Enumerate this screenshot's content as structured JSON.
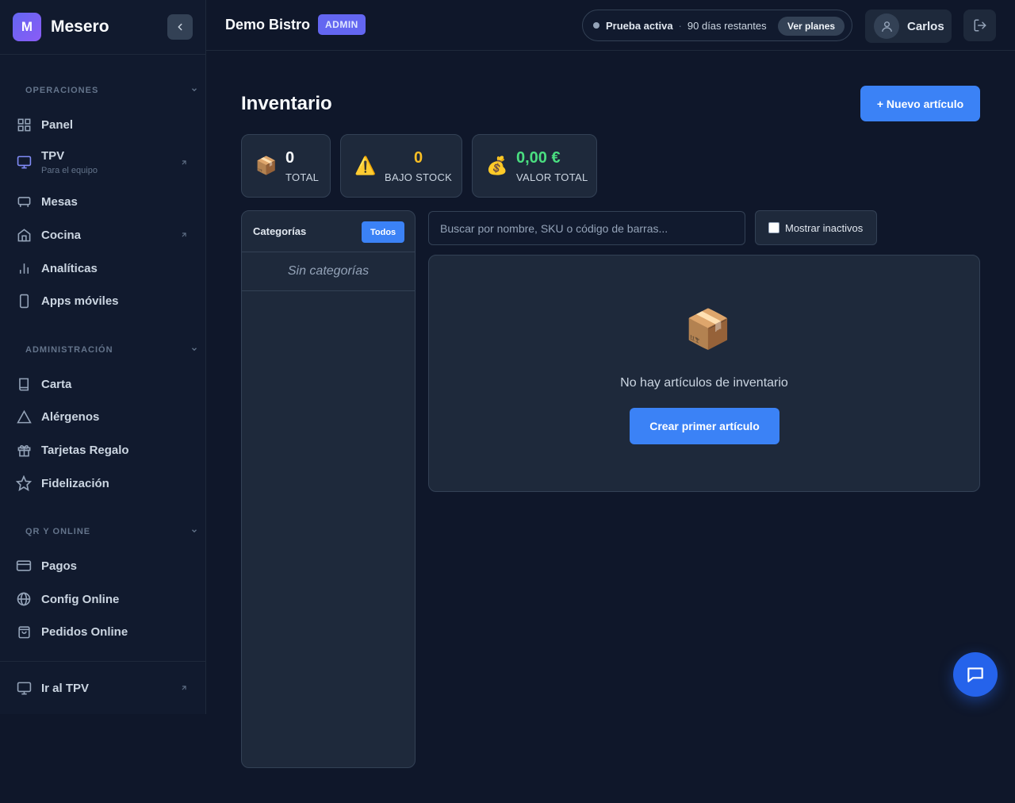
{
  "brand": {
    "initial": "M",
    "name": "Mesero"
  },
  "sidebar": {
    "sections": [
      {
        "title": "OPERACIONES"
      },
      {
        "title": "ADMINISTRACIÓN"
      },
      {
        "title": "QR Y ONLINE"
      }
    ],
    "items": [
      {
        "label": "Panel",
        "icon": "grid-icon"
      },
      {
        "label": "TPV",
        "sub": "Para el equipo",
        "icon": "monitor-icon",
        "external": true
      },
      {
        "label": "Mesas",
        "icon": "table-icon"
      },
      {
        "label": "Cocina",
        "icon": "home-icon",
        "external": true
      },
      {
        "label": "Analíticas",
        "icon": "bar-chart-icon"
      },
      {
        "label": "Apps móviles",
        "icon": "smartphone-icon"
      },
      {
        "label": "Carta",
        "icon": "book-icon"
      },
      {
        "label": "Alérgenos",
        "icon": "warning-triangle-icon"
      },
      {
        "label": "Tarjetas Regalo",
        "icon": "gift-icon"
      },
      {
        "label": "Fidelización",
        "icon": "star-icon"
      },
      {
        "label": "Pagos",
        "icon": "credit-card-icon"
      },
      {
        "label": "Config Online",
        "icon": "globe-icon"
      },
      {
        "label": "Pedidos Online",
        "icon": "shopping-bag-icon"
      }
    ],
    "footer": {
      "label": "Ir al TPV",
      "icon": "monitor-icon"
    }
  },
  "header": {
    "org_name": "Demo Bistro",
    "role_badge": "ADMIN",
    "trial": {
      "status": "Prueba activa",
      "separator": "·",
      "days": "90 días restantes",
      "plans_button": "Ver planes"
    },
    "user": {
      "name": "Carlos"
    }
  },
  "main": {
    "title": "Inventario",
    "new_button": "+ Nuevo artículo",
    "stats": [
      {
        "emoji": "📦",
        "value": "0",
        "label": "TOTAL",
        "color": "#f8fafc"
      },
      {
        "emoji": "⚠️",
        "value": "0",
        "label": "BAJO STOCK",
        "color": "#fbbf24"
      },
      {
        "emoji": "💰",
        "value": "0,00 €",
        "label": "VALOR TOTAL",
        "color": "#4ade80"
      }
    ],
    "categories": {
      "title": "Categorías",
      "all_button": "Todos",
      "empty": "Sin categorías"
    },
    "search": {
      "placeholder": "Buscar por nombre, SKU o código de barras...",
      "value": ""
    },
    "show_inactive": {
      "label": "Mostrar inactivos",
      "checked": false
    },
    "empty_state": {
      "emoji": "📦",
      "text": "No hay artículos de inventario",
      "button": "Crear primer artículo"
    }
  },
  "colors": {
    "accent": "#3b82f6",
    "brand": "#6366f1",
    "warning": "#fbbf24",
    "success": "#4ade80"
  }
}
